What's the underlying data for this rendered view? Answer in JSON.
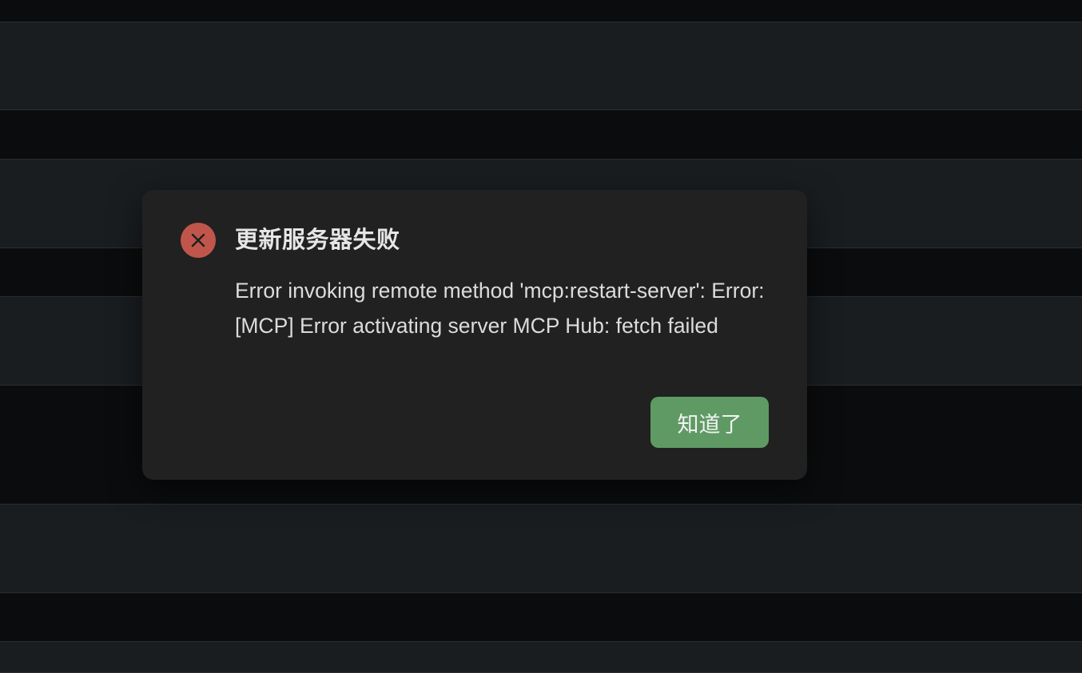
{
  "dialog": {
    "title": "更新服务器失败",
    "message": "Error invoking remote method 'mcp:restart-server': Error: [MCP] Error activating server MCP Hub: fetch failed",
    "ok_label": "知道了",
    "icon": "close-icon"
  },
  "colors": {
    "icon_background": "#c0564b",
    "button_background": "#5f9a65",
    "dialog_background": "#212121",
    "page_background": "#0b0c0d",
    "row_background": "#1a1d20"
  }
}
